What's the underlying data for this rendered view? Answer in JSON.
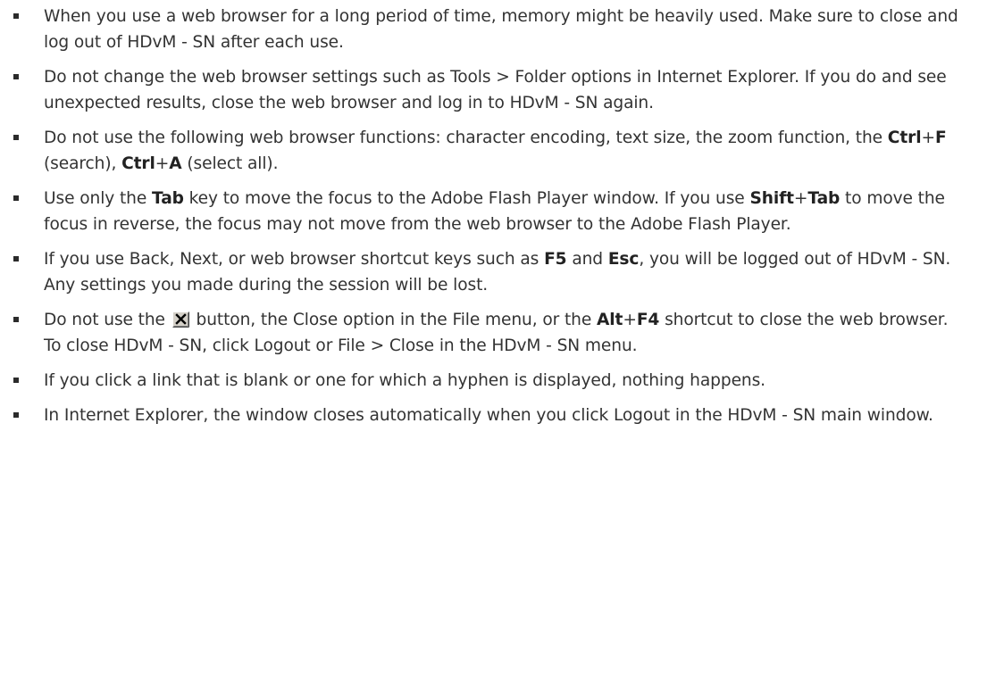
{
  "notes": [
    {
      "text": "When you use a web browser for a long period of time, memory might be heavily used. Make sure to close and log out of HDvM - SN after each use."
    },
    {
      "text": "Do not change the web browser settings such as Tools > Folder options in Internet Explorer. If you do and see unexpected results, close the web browser and log in to HDvM - SN again."
    },
    {
      "t1": "Do not use the following web browser functions: character encoding, text size, the zoom function, the ",
      "k1": "Ctrl",
      "p1": "+",
      "k2": "F",
      "t2": " (search), ",
      "k3": "Ctrl",
      "p2": "+",
      "k4": "A",
      "t3": " (select all)."
    },
    {
      "t1": "Use only the ",
      "k1": "Tab",
      "t2": " key to move the focus to the Adobe Flash Player window. If you use ",
      "k2": "Shift",
      "p1": "+",
      "k3": "Tab",
      "t3": " to move the focus in reverse, the focus may not move from the web browser to the Adobe Flash Player."
    },
    {
      "t1": "If you use Back, Next, or web browser shortcut keys such as ",
      "k1": "F5",
      "t2": " and ",
      "k2": "Esc",
      "t3": ", you will be logged out of HDvM - SN. Any settings you made during the session will be lost."
    },
    {
      "t1": "Do not use the ",
      "icon": "close-window-button-icon",
      "t2": " button, the Close option in the File menu, or the ",
      "k1": "Alt",
      "p1": "+",
      "k2": "F4",
      "t3": " shortcut to close the web browser. To close HDvM - SN, click Logout or File > Close in the HDvM - SN menu."
    },
    {
      "text": "If you click a link that is blank or one for which a hyphen is displayed, nothing happens."
    },
    {
      "text": "In Internet Explorer, the window closes automatically when you click Logout in the HDvM - SN main window."
    }
  ],
  "colors": {
    "text": "#333333",
    "bullet": "#2b2b2b",
    "icon_bg": "#d4d0c8"
  }
}
